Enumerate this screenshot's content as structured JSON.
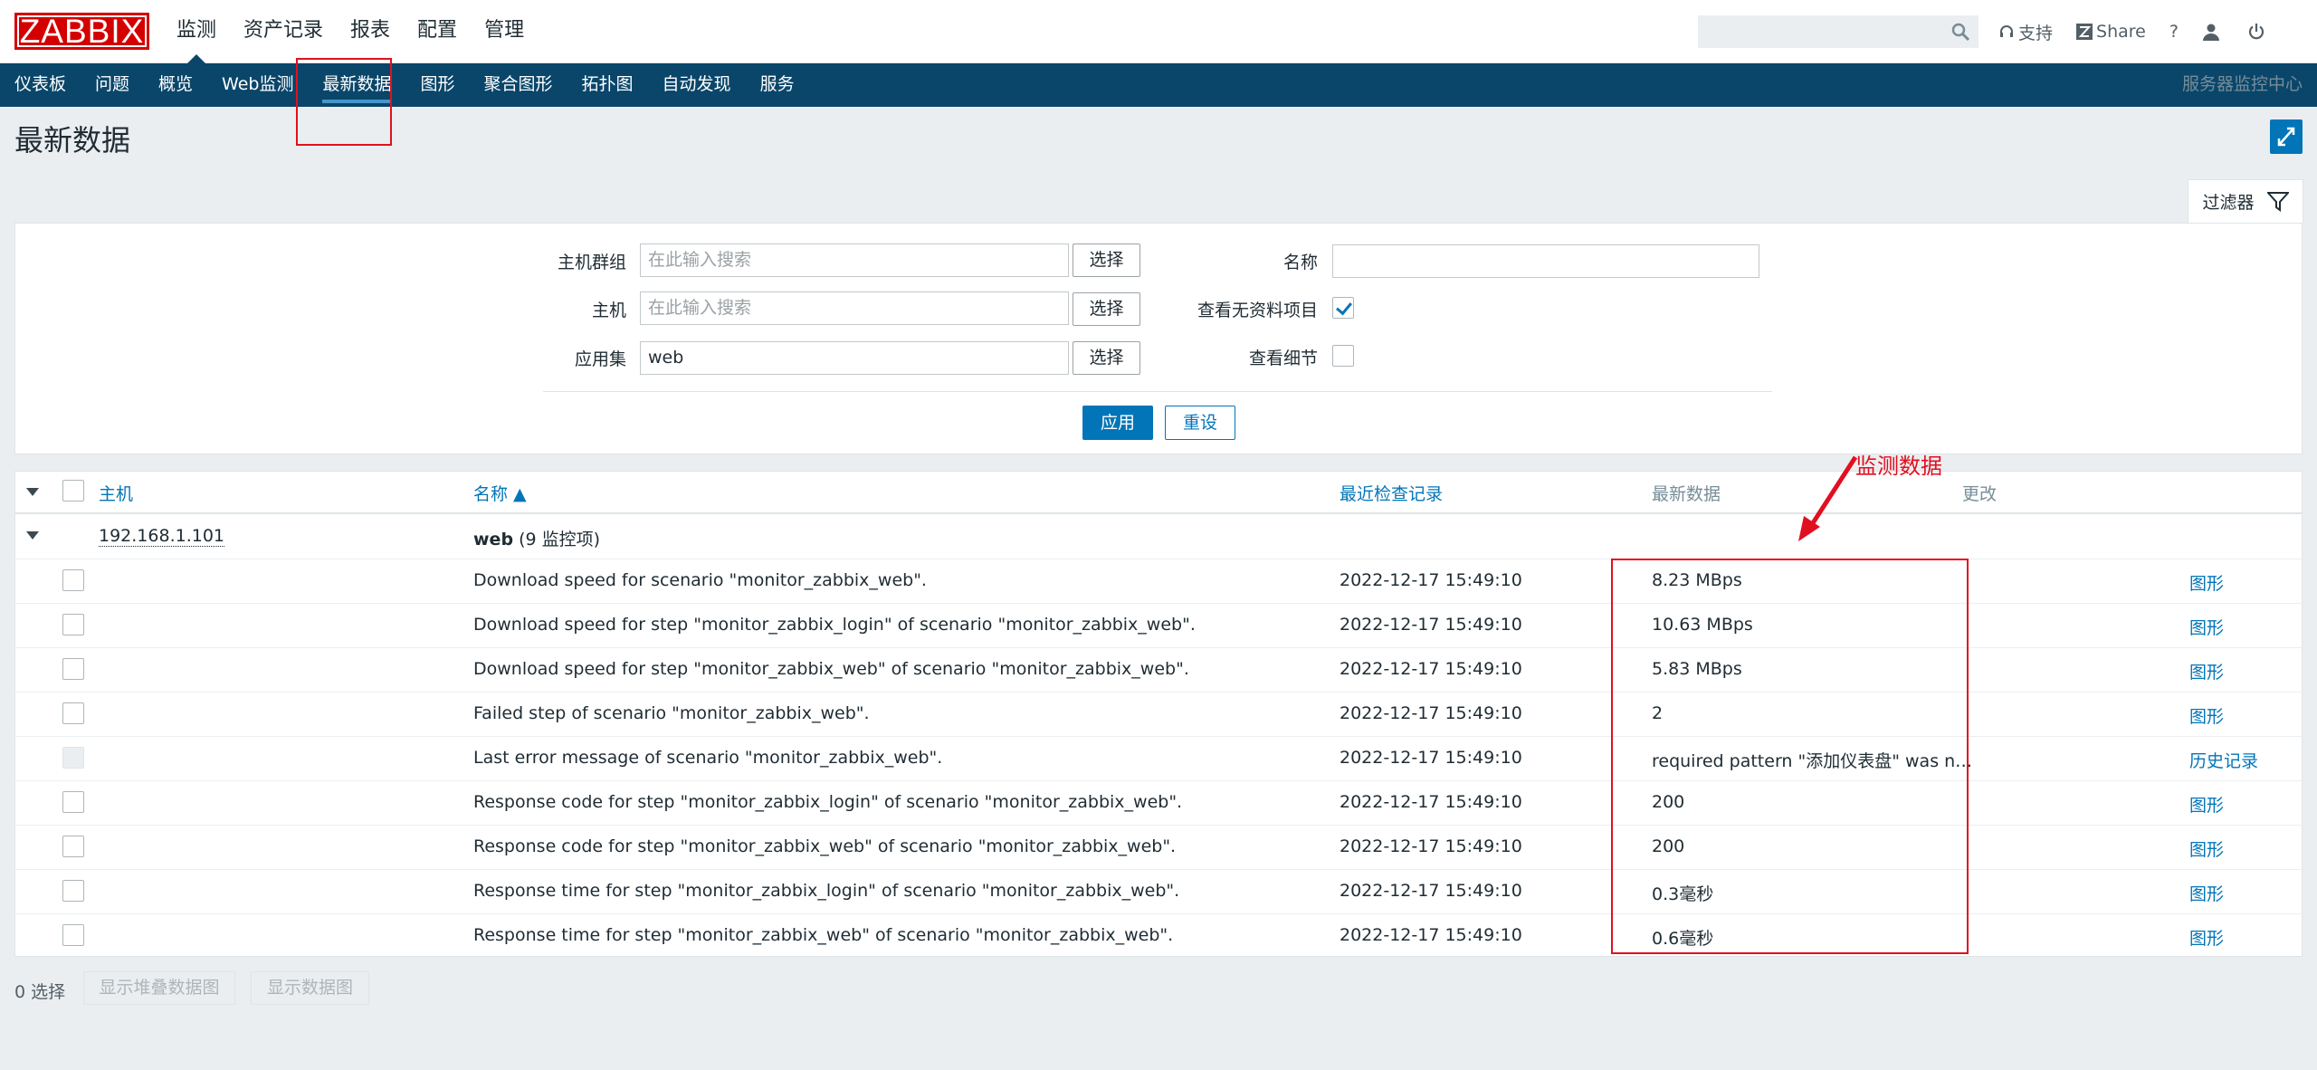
{
  "header": {
    "logo": "ZABBIX",
    "nav": [
      "监测",
      "资产记录",
      "报表",
      "配置",
      "管理"
    ],
    "links": {
      "support": "支持",
      "share": "Share",
      "help": "?"
    }
  },
  "subnav": {
    "items": [
      "仪表板",
      "问题",
      "概览",
      "Web监测",
      "最新数据",
      "图形",
      "聚合图形",
      "拓扑图",
      "自动发现",
      "服务"
    ],
    "right": "服务器监控中心"
  },
  "page": {
    "title": "最新数据"
  },
  "filter": {
    "tab_label": "过滤器",
    "host_group_label": "主机群组",
    "host_group_placeholder": "在此输入搜索",
    "host_label": "主机",
    "host_placeholder": "在此输入搜索",
    "app_label": "应用集",
    "app_value": "web",
    "select_label": "选择",
    "name_label": "名称",
    "name_value": "",
    "show_no_data_label": "查看无资料项目",
    "show_no_data_checked": true,
    "show_details_label": "查看细节",
    "show_details_checked": false,
    "apply": "应用",
    "reset": "重设"
  },
  "table": {
    "columns": {
      "host": "主机",
      "name": "名称 ▲",
      "last_check": "最近检查记录",
      "last_value": "最新数据",
      "change": "更改"
    },
    "group": {
      "host": "192.168.1.101",
      "app": "web",
      "count": "(9 监控项)"
    },
    "rows": [
      {
        "name": "Download speed for scenario \"monitor_zabbix_web\".",
        "time": "2022-12-17 15:49:10",
        "value": "8.23 MBps",
        "action": "图形"
      },
      {
        "name": "Download speed for step \"monitor_zabbix_login\" of scenario \"monitor_zabbix_web\".",
        "time": "2022-12-17 15:49:10",
        "value": "10.63 MBps",
        "action": "图形"
      },
      {
        "name": "Download speed for step \"monitor_zabbix_web\" of scenario \"monitor_zabbix_web\".",
        "time": "2022-12-17 15:49:10",
        "value": "5.83 MBps",
        "action": "图形"
      },
      {
        "name": "Failed step of scenario \"monitor_zabbix_web\".",
        "time": "2022-12-17 15:49:10",
        "value": "2",
        "action": "图形"
      },
      {
        "name": "Last error message of scenario \"monitor_zabbix_web\".",
        "time": "2022-12-17 15:49:10",
        "value": "required pattern \"添加仪表盘\" was n…",
        "action": "历史记录"
      },
      {
        "name": "Response code for step \"monitor_zabbix_login\" of scenario \"monitor_zabbix_web\".",
        "time": "2022-12-17 15:49:10",
        "value": "200",
        "action": "图形"
      },
      {
        "name": "Response code for step \"monitor_zabbix_web\" of scenario \"monitor_zabbix_web\".",
        "time": "2022-12-17 15:49:10",
        "value": "200",
        "action": "图形"
      },
      {
        "name": "Response time for step \"monitor_zabbix_login\" of scenario \"monitor_zabbix_web\".",
        "time": "2022-12-17 15:49:10",
        "value": "0.3毫秒",
        "action": "图形"
      },
      {
        "name": "Response time for step \"monitor_zabbix_web\" of scenario \"monitor_zabbix_web\".",
        "time": "2022-12-17 15:49:10",
        "value": "0.6毫秒",
        "action": "图形"
      }
    ]
  },
  "footer": {
    "selected": "0 选择",
    "stacked_graph": "显示堆叠数据图",
    "graph": "显示数据图"
  },
  "annotation": {
    "text": "监测数据"
  },
  "colors": {
    "accent": "#0275b8",
    "subnav_bg": "#0a466a",
    "annotation": "#e01020",
    "logo": "#d40000"
  }
}
